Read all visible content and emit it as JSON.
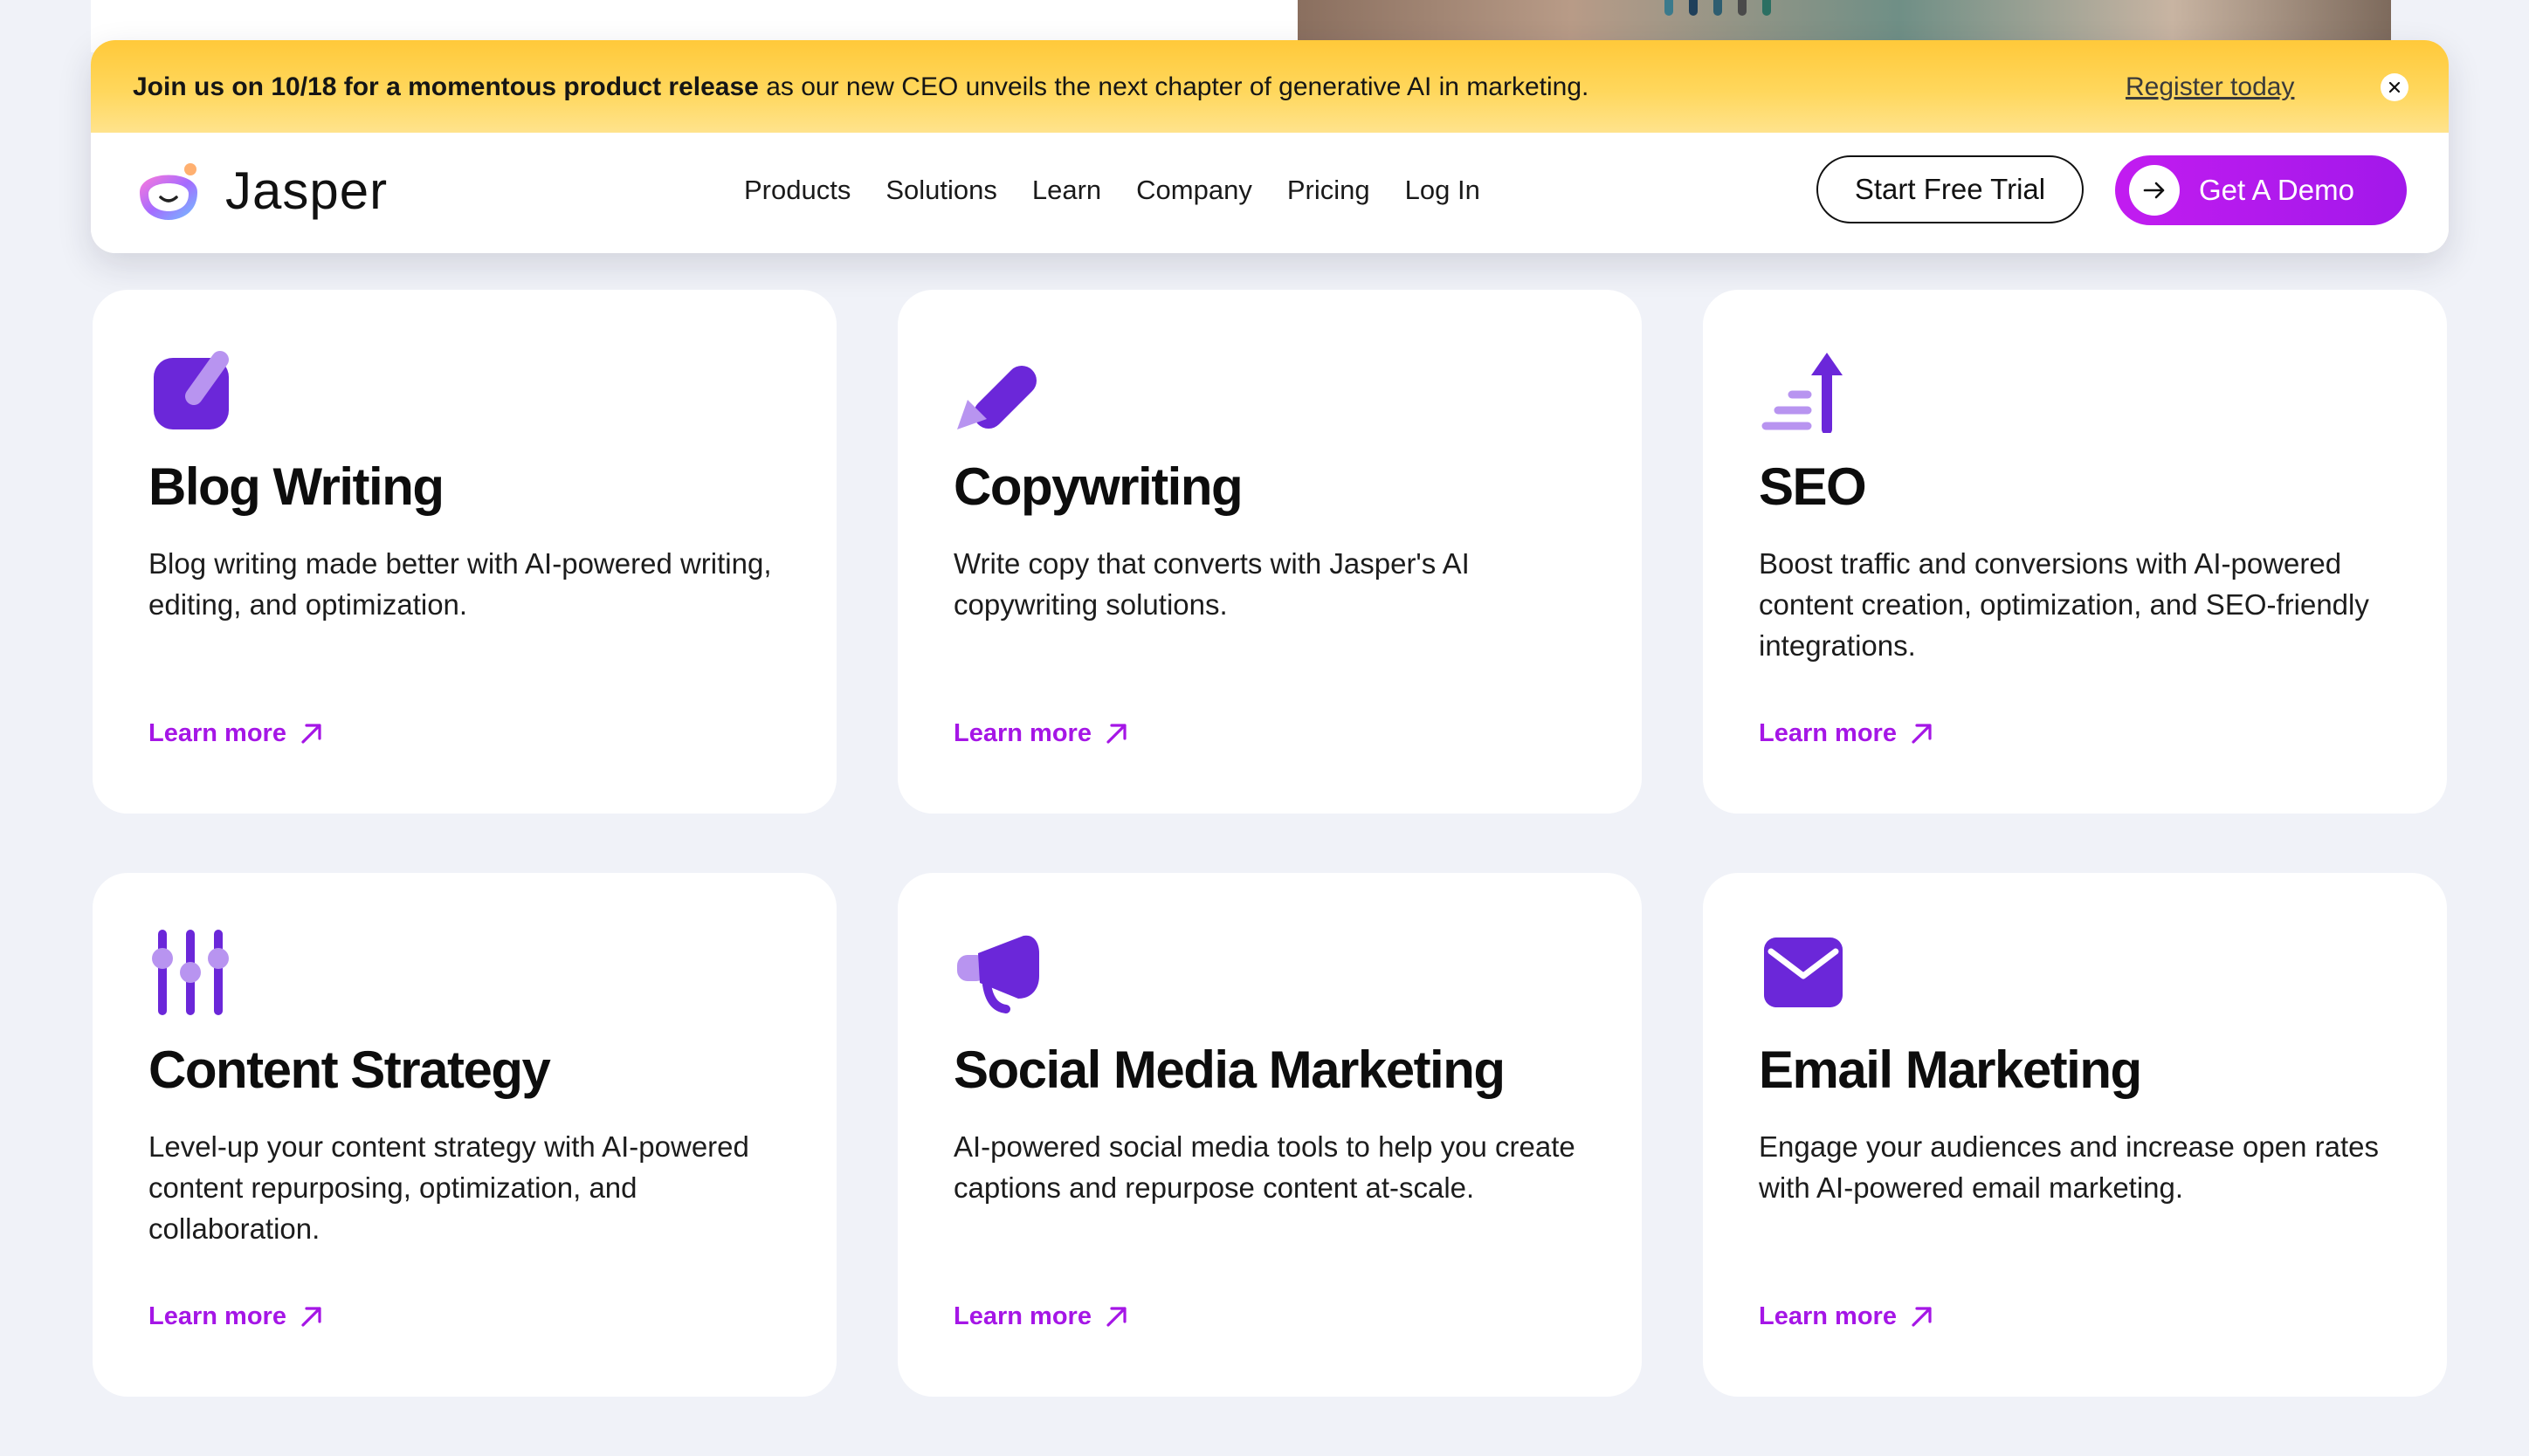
{
  "banner": {
    "bold_text": "Join us on 10/18 for a momentous product release",
    "rest_text": " as our new CEO unveils the next chapter of generative AI in marketing.",
    "link_label": "Register today",
    "close_icon": "close-icon"
  },
  "header": {
    "logo_text": "Jasper",
    "nav": [
      "Products",
      "Solutions",
      "Learn",
      "Company",
      "Pricing",
      "Log In"
    ],
    "trial_label": "Start Free Trial",
    "demo_label": "Get A Demo"
  },
  "colors": {
    "accent": "#a516e6",
    "icon_primary": "#6b27d9",
    "icon_light": "#b894f0",
    "banner": "#ffd04a"
  },
  "cards": [
    {
      "icon": "blog-writing-icon",
      "title": "Blog Writing",
      "description": "Blog writing made better with AI-powered writing, editing, and optimization.",
      "link": "Learn more"
    },
    {
      "icon": "pencil-icon",
      "title": "Copywriting",
      "description": "Write copy that converts with Jasper's AI copywriting solutions.",
      "link": "Learn more"
    },
    {
      "icon": "seo-arrow-up-icon",
      "title": "SEO",
      "description": "Boost traffic and conversions with AI-powered content creation, optimization, and SEO-friendly integrations.",
      "link": "Learn more"
    },
    {
      "icon": "sliders-icon",
      "title": "Content Strategy",
      "description": "Level-up your content strategy with AI-powered content repurposing, optimization, and collaboration.",
      "link": "Learn more"
    },
    {
      "icon": "megaphone-icon",
      "title": "Social Media Marketing",
      "description": "AI-powered social media tools to help you create captions and repurpose content at-scale.",
      "link": "Learn more"
    },
    {
      "icon": "envelope-icon",
      "title": "Email Marketing",
      "description": "Engage your audiences and increase open rates with AI-powered email marketing.",
      "link": "Learn more"
    }
  ]
}
